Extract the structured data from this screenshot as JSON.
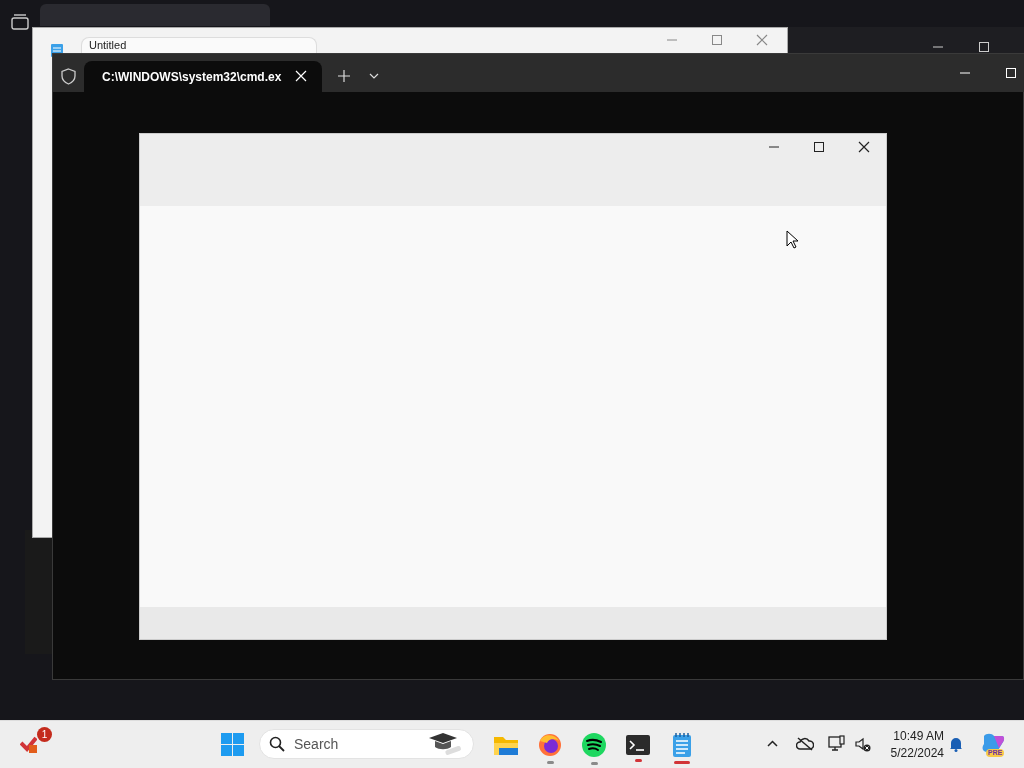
{
  "notepad_window": {
    "tab_title": "Untitled"
  },
  "terminal_window": {
    "tab_title": "C:\\WINDOWS\\system32\\cmd.ex",
    "tab_selected": true
  },
  "taskbar": {
    "widget_badge": "1",
    "search_placeholder": "Search",
    "apps": [
      {
        "kind": "explorer",
        "running": false,
        "active": false
      },
      {
        "kind": "firefox",
        "running": true,
        "active": false,
        "color": "#8a8a8a"
      },
      {
        "kind": "spotify",
        "running": true,
        "active": false,
        "color": "#8a8a8a"
      },
      {
        "kind": "terminal",
        "running": true,
        "active": false,
        "color": "#d13438"
      },
      {
        "kind": "notepad",
        "running": true,
        "active": true,
        "color": "#d13438"
      }
    ],
    "time": "10:49 AM",
    "date": "5/22/2024",
    "copilot_badge": "PRE"
  }
}
